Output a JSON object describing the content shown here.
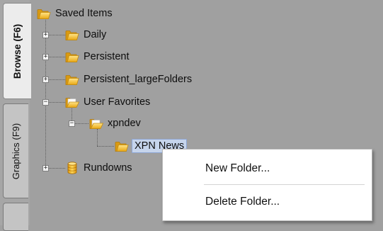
{
  "tabs": [
    {
      "id": "browse",
      "label": "Browse (F6)"
    },
    {
      "id": "graphics",
      "label": "Graphics (F9)"
    },
    {
      "id": "third",
      "label": ""
    }
  ],
  "tree": {
    "root": {
      "label": "Saved Items",
      "icon": "folder-icon"
    },
    "daily": {
      "label": "Daily",
      "icon": "folder-icon",
      "expander": "+"
    },
    "persistent": {
      "label": "Persistent",
      "icon": "folder-icon",
      "expander": "+"
    },
    "persistent_large": {
      "label": "Persistent_largeFolders",
      "icon": "folder-icon",
      "expander": "+"
    },
    "user_favorites": {
      "label": "User Favorites",
      "icon": "folder-open-icon",
      "expander": "−"
    },
    "xpndev": {
      "label": "xpndev",
      "icon": "folder-open-icon",
      "expander": "−"
    },
    "xpn_news": {
      "label": "XPN News",
      "icon": "folder-icon",
      "selected": true
    },
    "rundowns": {
      "label": "Rundowns",
      "icon": "database-icon",
      "expander": "+"
    }
  },
  "context_menu": {
    "items": [
      {
        "label": "New Folder..."
      },
      {
        "label": "Delete Folder..."
      }
    ]
  },
  "colors": {
    "panel_bg": "#a0a0a0",
    "selection_bg": "#c6d5ec",
    "folder_yellow": "#f2c12e"
  }
}
